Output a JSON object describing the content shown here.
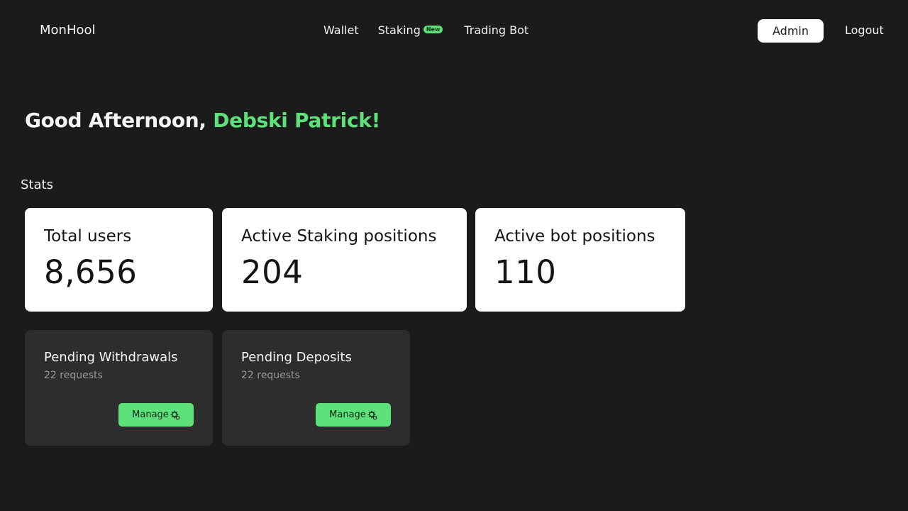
{
  "brand": "MonHool",
  "nav": {
    "wallet": "Wallet",
    "staking": "Staking",
    "staking_badge": "New",
    "trading_bot": "Trading Bot"
  },
  "header": {
    "admin": "Admin",
    "logout": "Logout"
  },
  "greeting": {
    "prefix": "Good Afternoon, ",
    "name": "Debski Patrick!"
  },
  "stats": {
    "title": "Stats",
    "cards": [
      {
        "label": "Total users",
        "value": "8,656"
      },
      {
        "label": "Active Staking positions",
        "value": "204"
      },
      {
        "label": "Active bot positions",
        "value": "110"
      }
    ]
  },
  "pending": [
    {
      "title": "Pending Withdrawals",
      "subtitle": "22 requests",
      "button": "Manage",
      "icon": "manage-gear-icon"
    },
    {
      "title": "Pending Deposits",
      "subtitle": "22 requests",
      "button": "Manage",
      "icon": "manage-gear-icon"
    }
  ],
  "colors": {
    "background": "#1b1b1b",
    "accent": "#5ee07a",
    "card": "#ffffff",
    "card_dark": "#2d2d2d"
  }
}
